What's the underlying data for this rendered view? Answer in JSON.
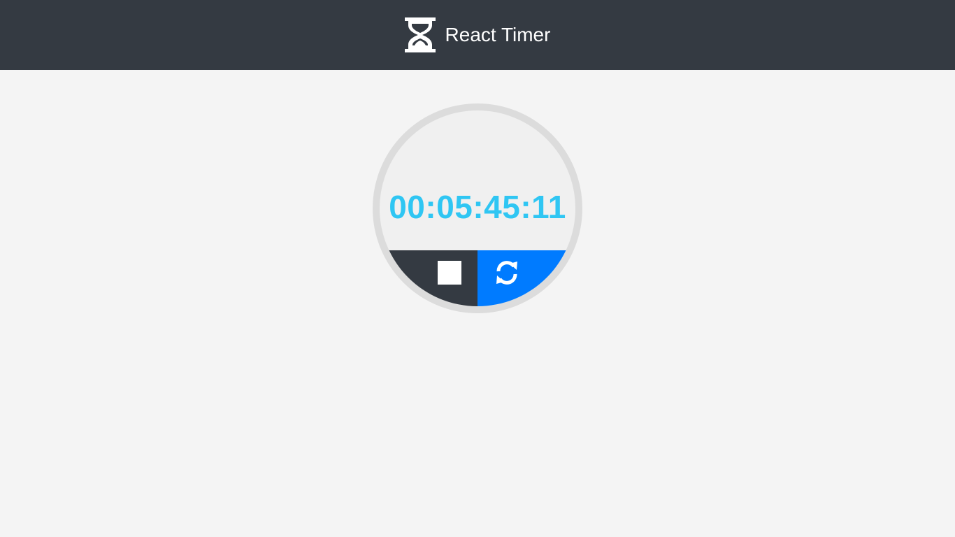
{
  "header": {
    "title": "React Timer",
    "logo_icon": "hourglass-icon",
    "background": "#343a42"
  },
  "timer": {
    "display": "00:05:45:11",
    "color": "#2fc6f3"
  },
  "controls": {
    "stop": {
      "icon": "stop-icon",
      "color": "#343a42"
    },
    "reset": {
      "icon": "reset-icon",
      "color": "#007bff"
    }
  }
}
